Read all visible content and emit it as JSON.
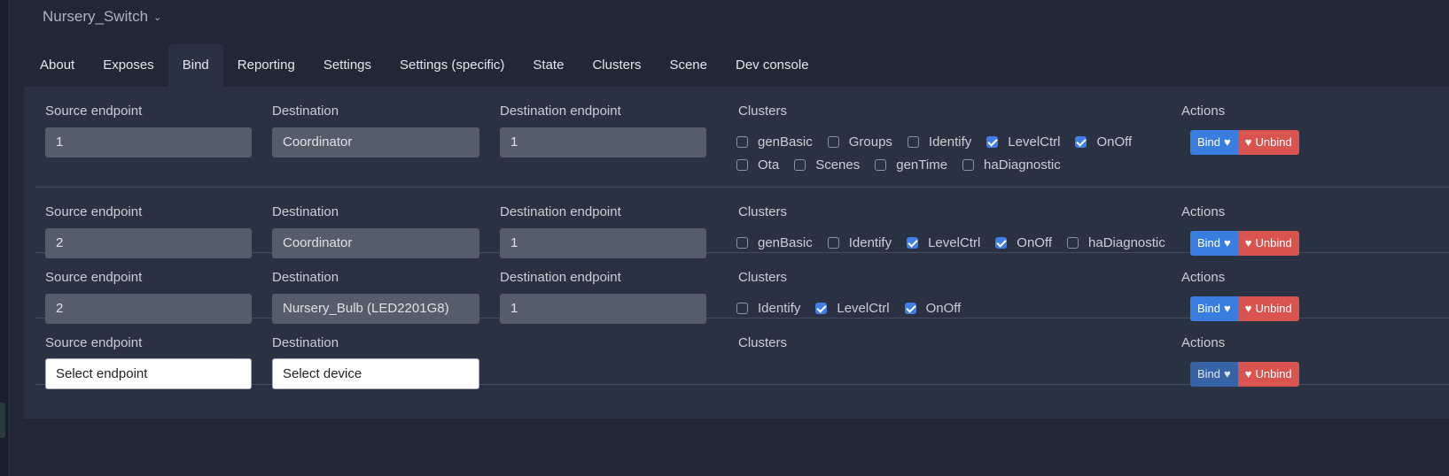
{
  "device": {
    "name": "Nursery_Switch"
  },
  "tabs": [
    "About",
    "Exposes",
    "Bind",
    "Reporting",
    "Settings",
    "Settings (specific)",
    "State",
    "Clusters",
    "Scene",
    "Dev console"
  ],
  "active_tab": "Bind",
  "labels": {
    "source_endpoint": "Source endpoint",
    "destination": "Destination",
    "destination_endpoint": "Destination endpoint",
    "clusters": "Clusters",
    "actions": "Actions",
    "bind": "Bind",
    "unbind": "Unbind"
  },
  "rows": [
    {
      "source": "1",
      "destination": "Coordinator",
      "dest_endpoint": "1",
      "cluster_lines": [
        [
          {
            "name": "genBasic",
            "checked": false
          },
          {
            "name": "Groups",
            "checked": false
          },
          {
            "name": "Identify",
            "checked": false
          },
          {
            "name": "LevelCtrl",
            "checked": true
          },
          {
            "name": "OnOff",
            "checked": true
          }
        ],
        [
          {
            "name": "Ota",
            "checked": false
          },
          {
            "name": "Scenes",
            "checked": false
          },
          {
            "name": "genTime",
            "checked": false
          },
          {
            "name": "haDiagnostic",
            "checked": false
          }
        ]
      ]
    },
    {
      "source": "2",
      "destination": "Coordinator",
      "dest_endpoint": "1",
      "cluster_lines": [
        [
          {
            "name": "genBasic",
            "checked": false
          },
          {
            "name": "Identify",
            "checked": false
          },
          {
            "name": "LevelCtrl",
            "checked": true
          },
          {
            "name": "OnOff",
            "checked": true
          },
          {
            "name": "haDiagnostic",
            "checked": false
          }
        ]
      ]
    },
    {
      "source": "2",
      "destination": "Nursery_Bulb (LED2201G8)",
      "dest_endpoint": "1",
      "cluster_lines": [
        [
          {
            "name": "Identify",
            "checked": false
          },
          {
            "name": "LevelCtrl",
            "checked": true
          },
          {
            "name": "OnOff",
            "checked": true
          }
        ]
      ]
    }
  ],
  "new_row": {
    "source_placeholder": "Select endpoint",
    "destination_placeholder": "Select device"
  },
  "colors": {
    "bind": "#3a7de0",
    "unbind": "#d9534f",
    "checkbox_on": "#3f7ee8"
  },
  "icons": {
    "title": "chevron-down-icon",
    "bind": "heart-icon",
    "unbind": "broken-heart-icon"
  }
}
